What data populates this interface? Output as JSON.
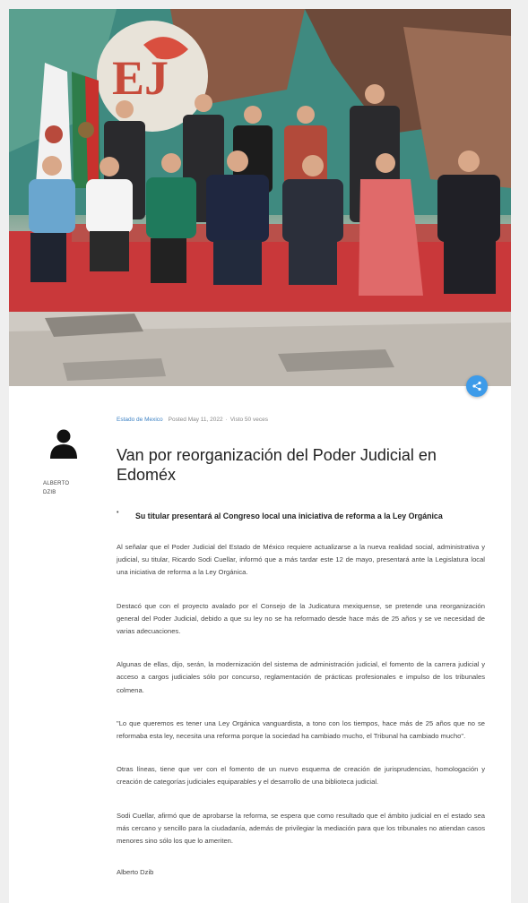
{
  "article": {
    "category": "Estado de Mexico",
    "posted": "Posted May 11, 2022",
    "views": "Visto 50 veces",
    "title": "Van por reorganización del Poder Judicial en Edoméx",
    "lead": "Su titular presentará al Congreso local una iniciativa de reforma a la Ley Orgánica",
    "paragraphs": [
      "Al señalar que el Poder Judicial del Estado de México requiere actualizarse a la nueva realidad social, administrativa y judicial, su titular, Ricardo Sodi Cuellar, informó que a más tardar este 12 de mayo, presentará ante la Legislatura local una iniciativa de reforma a la Ley Orgánica.",
      "Destacó que con el proyecto avalado por el Consejo de la Judicatura mexiquense, se pretende una reorganización general del Poder Judicial, debido a que su ley no se ha reformado desde hace más de 25 años y se ve necesidad de varias adecuaciones.",
      "Algunas de ellas, dijo, serán, la modernización del sistema de administración judicial, el fomento de la carrera judicial y acceso a cargos judiciales sólo por concurso, reglamentación de prácticas profesionales e impulso de los tribunales colmena.",
      "\"Lo que queremos es tener una Ley Orgánica vanguardista, a tono con los tiempos, hace más de 25 años que no se reformaba esta ley, necesita una reforma porque la sociedad ha cambiado mucho, el Tribunal ha cambiado mucho\".",
      "Otras líneas, tiene que ver con el fomento de un nuevo esquema de creación de jurisprudencias, homologación y creación de categorías judiciales equiparables y el desarrollo de una biblioteca judicial.",
      "Sodi Cuellar, afirmó que de aprobarse la reforma, se espera que como resultado que el ámbito judicial en el estado sea más cercano y sencillo para la ciudadanía, además de privilegiar la mediación para que los tribunales no atiendan casos menores sino sólo los que lo ameriten."
    ],
    "signature": "Alberto Dzib"
  },
  "author": {
    "name": "ALBERTO DZIB",
    "avatar_icon": "user-silhouette-icon"
  },
  "share": {
    "icon": "share-icon",
    "color": "#3d9be9"
  },
  "colors": {
    "category_link": "#3d82c4",
    "background": "#efefef"
  }
}
